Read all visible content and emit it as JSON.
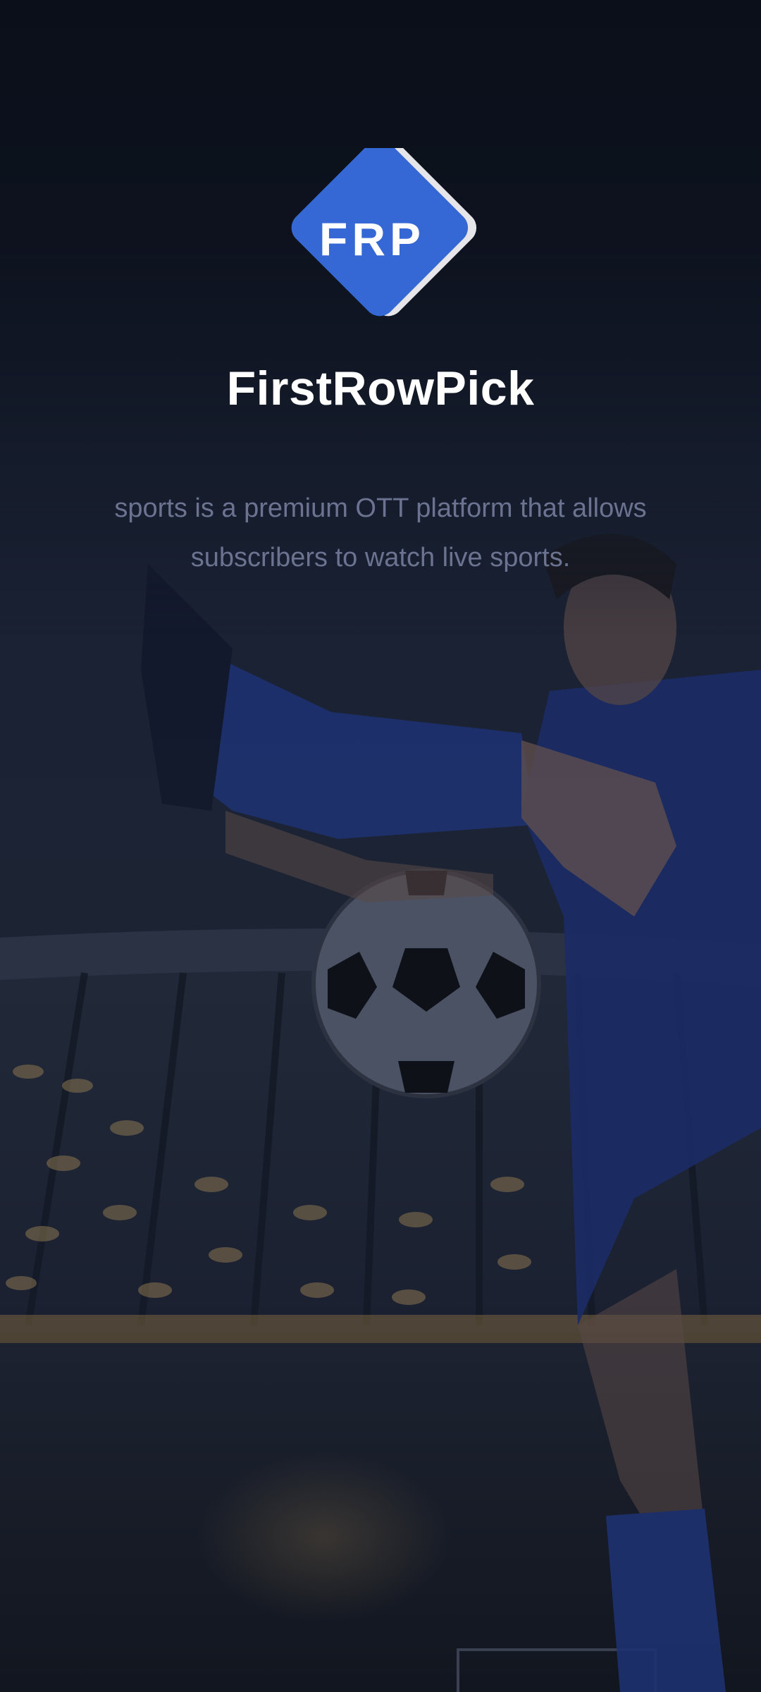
{
  "app": {
    "logo_text": "FRP",
    "name": "FirstRowPick",
    "tagline": "sports is a premium OTT platform that allows subscribers to watch live sports."
  },
  "background": {
    "description_icon": "soccer-player-stadium-image"
  },
  "colors": {
    "logo_blue": "#3568d4",
    "logo_shadow": "#e6e6ea",
    "title": "#ffffff",
    "tagline": "#6b7390",
    "background_dark": "#0d111c"
  }
}
